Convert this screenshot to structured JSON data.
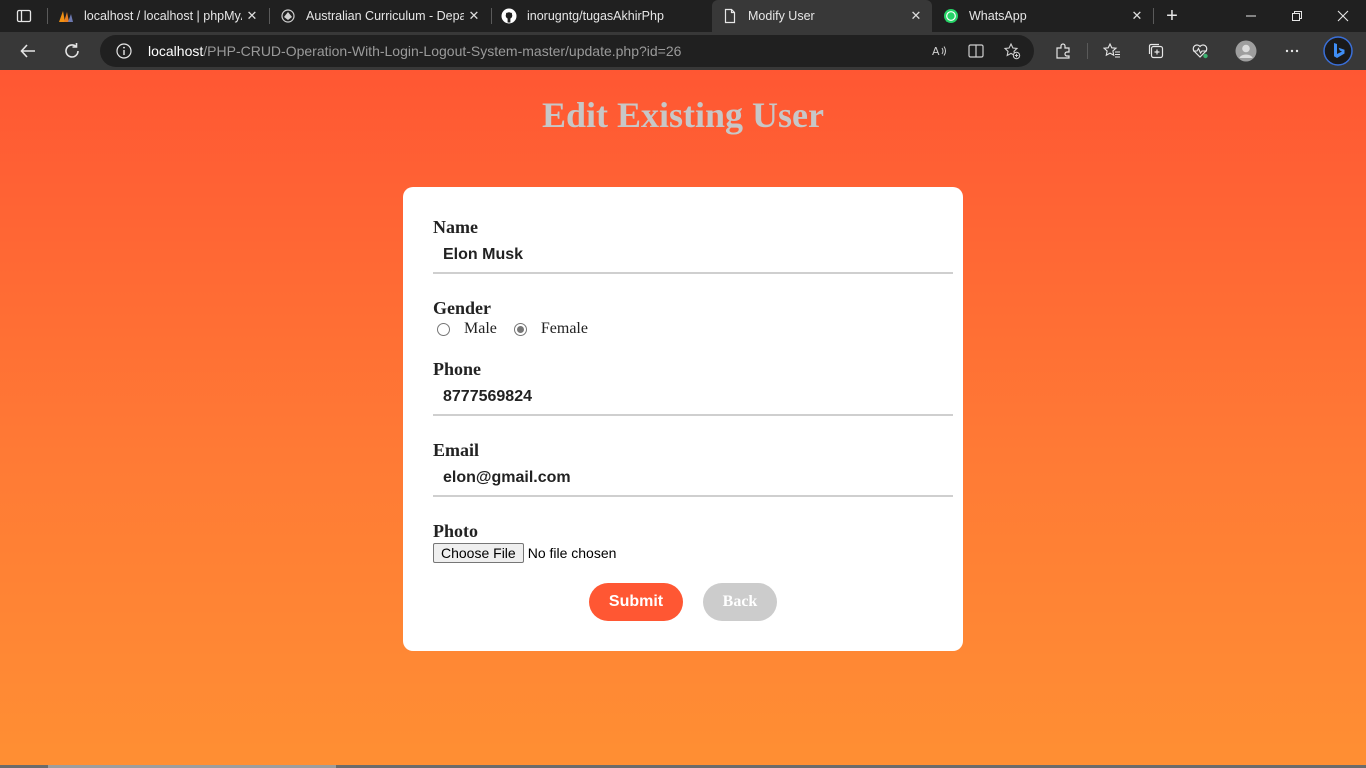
{
  "browser": {
    "tabs": [
      {
        "title": "localhost / localhost | phpMyAdmin",
        "icon": "phpmyadmin-icon"
      },
      {
        "title": "Australian Curriculum - Department",
        "icon": "coat-of-arms-icon"
      },
      {
        "title": "inorugntg/tugasAkhirPhp",
        "icon": "github-icon"
      },
      {
        "title": "Modify User",
        "icon": "page-icon",
        "active": true
      },
      {
        "title": "WhatsApp",
        "icon": "whatsapp-icon"
      }
    ],
    "url_host": "localhost",
    "url_path": "/PHP-CRUD-Operation-With-Login-Logout-System-master/update.php?id=26"
  },
  "page": {
    "title": "Edit Existing User",
    "form": {
      "name_label": "Name",
      "name_value": "Elon Musk",
      "gender_label": "Gender",
      "gender_options": [
        "Male",
        "Female"
      ],
      "gender_selected": "Female",
      "phone_label": "Phone",
      "phone_value": "8777569824",
      "email_label": "Email",
      "email_value": "elon@gmail.com",
      "photo_label": "Photo",
      "file_button": "Choose File",
      "file_status": "No file chosen",
      "submit_label": "Submit",
      "back_label": "Back"
    }
  },
  "colors": {
    "gradient_top": "#ff5733",
    "gradient_bottom": "#ff8f33",
    "title": "#c7c7c7",
    "submit": "#ff5733",
    "back": "#cccccc"
  }
}
